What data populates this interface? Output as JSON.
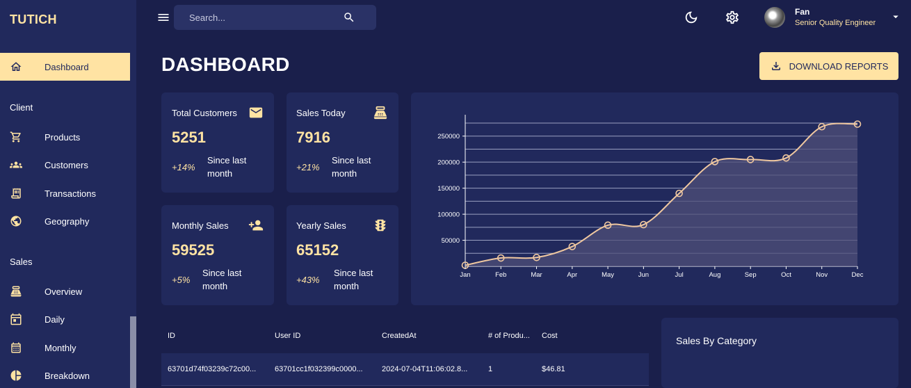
{
  "brand": "TUTICH",
  "sidebar": {
    "dashboard": {
      "label": "Dashboard",
      "icon": "home-icon"
    },
    "section_client": "Client",
    "client_items": [
      {
        "label": "Products",
        "icon": "cart-icon"
      },
      {
        "label": "Customers",
        "icon": "groups-icon"
      },
      {
        "label": "Transactions",
        "icon": "receipt-icon"
      },
      {
        "label": "Geography",
        "icon": "globe-icon"
      }
    ],
    "section_sales": "Sales",
    "sales_items": [
      {
        "label": "Overview",
        "icon": "point-of-sale-icon"
      },
      {
        "label": "Daily",
        "icon": "calendar-today-icon"
      },
      {
        "label": "Monthly",
        "icon": "calendar-month-icon"
      },
      {
        "label": "Breakdown",
        "icon": "pie-chart-icon"
      }
    ]
  },
  "topbar": {
    "search_placeholder": "Search...",
    "user": {
      "name": "Fan",
      "role": "Senior Quality Engineer"
    }
  },
  "page": {
    "title": "DASHBOARD",
    "download_label": "DOWNLOAD REPORTS"
  },
  "stats": [
    {
      "title": "Total Customers",
      "value": "5251",
      "pct": "+14%",
      "since": "Since last month",
      "icon": "email-icon"
    },
    {
      "title": "Sales Today",
      "value": "7916",
      "pct": "+21%",
      "since": "Since last month",
      "icon": "point-of-sale-icon"
    },
    {
      "title": "Monthly Sales",
      "value": "59525",
      "pct": "+5%",
      "since": "Since last month",
      "icon": "person-add-icon"
    },
    {
      "title": "Yearly Sales",
      "value": "65152",
      "pct": "+43%",
      "since": "Since last month",
      "icon": "traffic-icon"
    }
  ],
  "chart_data": {
    "type": "area",
    "categories": [
      "Jan",
      "Feb",
      "Mar",
      "Apr",
      "May",
      "Jun",
      "Jul",
      "Aug",
      "Sep",
      "Oct",
      "Nov",
      "Dec"
    ],
    "values": [
      2000,
      16000,
      17000,
      38000,
      79000,
      80000,
      140000,
      201000,
      205000,
      208000,
      268000,
      273000
    ],
    "yticks": [
      50000,
      100000,
      150000,
      200000,
      250000
    ],
    "ylim": [
      0,
      275000
    ],
    "grid": true,
    "colors": {
      "line": "#f0c8a0",
      "fill": "#4f4f78"
    }
  },
  "table": {
    "headers": [
      "ID",
      "User ID",
      "CreatedAt",
      "# of Produ...",
      "Cost"
    ],
    "rows": [
      [
        "63701d74f03239c72c00...",
        "63701cc1f032399c0000...",
        "2024-07-04T11:06:02.8...",
        "1",
        "$46.81"
      ]
    ]
  },
  "category_panel": {
    "title": "Sales By Category"
  }
}
